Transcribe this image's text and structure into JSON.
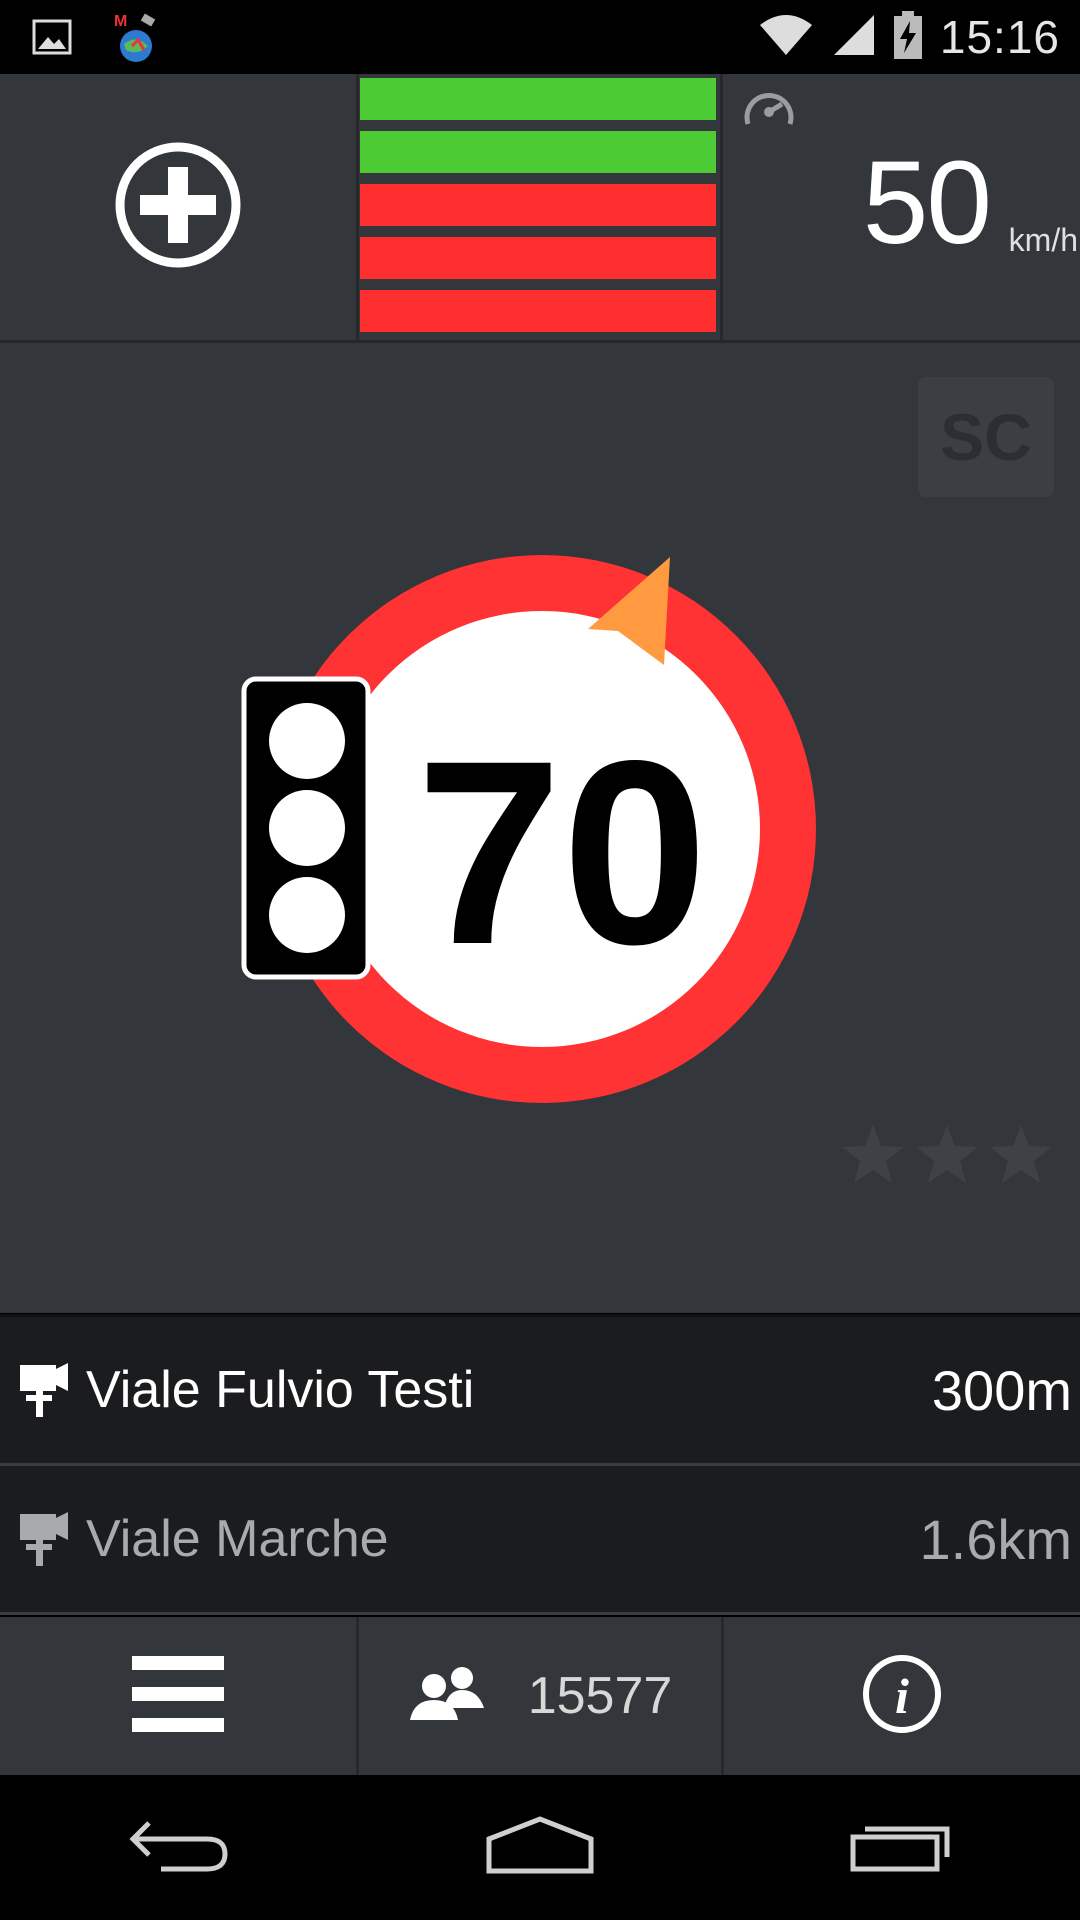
{
  "status_bar": {
    "time": "15:16",
    "icons": [
      "gallery-icon",
      "app-notification-icon",
      "wifi-icon",
      "signal-icon",
      "battery-charging-icon"
    ]
  },
  "top_bar": {
    "add_icon": "plus-circle-icon",
    "signal_bars": [
      {
        "color": "#4ccb35"
      },
      {
        "color": "#4ccb35"
      },
      {
        "color": "#ff2f2f"
      },
      {
        "color": "#ff2f2f"
      },
      {
        "color": "#ff2f2f"
      }
    ],
    "speed_icon": "speedometer-icon",
    "current_speed": "50",
    "speed_unit": "km/h"
  },
  "main": {
    "badge_text": "SC",
    "speed_limit": "70",
    "sign_ring_color": "#ff3333",
    "direction_arrow_color": "#ff9a40",
    "rating_stars": 3
  },
  "alerts": [
    {
      "street": "Viale Fulvio Testi",
      "distance": "300m",
      "icon": "speed-camera-icon"
    },
    {
      "street": "Viale Marche",
      "distance": "1.6km",
      "icon": "speed-camera-icon"
    }
  ],
  "bottom_bar": {
    "menu_icon": "menu-icon",
    "users_icon": "users-icon",
    "users_count": "15577",
    "info_icon": "info-icon"
  },
  "nav_bar": {
    "icons": [
      "back-icon",
      "home-icon",
      "recents-icon"
    ]
  }
}
